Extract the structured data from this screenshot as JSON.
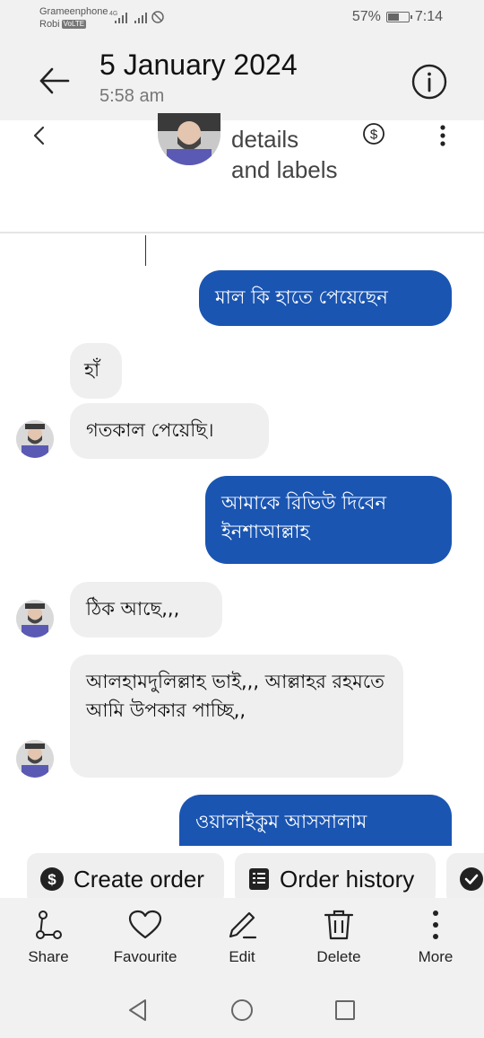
{
  "status_bar": {
    "carrier1": "Grameenphone",
    "carrier2": "Robi",
    "volte": "VoLTE",
    "network": "4G",
    "battery": "57%",
    "battery_level": 0.57,
    "time": "7:14"
  },
  "header": {
    "back_icon": "arrow-left-icon",
    "date": "5 January 2024",
    "time": "5:58 am",
    "info_icon": "info-icon"
  },
  "screenshot_header": {
    "title": "details and labels",
    "back_icon": "chevron-left-icon",
    "dollar_icon": "dollar-circle-icon",
    "more_icon": "more-vertical-icon"
  },
  "messages": [
    {
      "direction": "outgoing",
      "text": "মাল কি হাতে পেয়েছেন"
    },
    {
      "direction": "incoming",
      "text": "হাঁ"
    },
    {
      "direction": "incoming",
      "text": "গতকাল পেয়েছি।"
    },
    {
      "direction": "outgoing",
      "text": "আমাকে রিভিউ দিবেন ইনশাআল্লাহ"
    },
    {
      "direction": "incoming",
      "text": "ঠিক আছে,,,"
    },
    {
      "direction": "incoming",
      "text": "আলহামদুলিল্লাহ ভাই,,, আল্লাহর রহমতে আমি উপকার পাচ্ছি,,"
    },
    {
      "direction": "outgoing",
      "text": "ওয়ালাইকুম আসসালাম"
    }
  ],
  "chips": {
    "create_order": "Create order",
    "order_history": "Order history"
  },
  "toolbar": {
    "share": "Share",
    "favourite": "Favourite",
    "edit": "Edit",
    "delete": "Delete",
    "more": "More"
  },
  "colors": {
    "outgoing_bubble": "#1a55b2",
    "incoming_bubble": "#efefef",
    "bar_background": "#f1f1f1"
  }
}
